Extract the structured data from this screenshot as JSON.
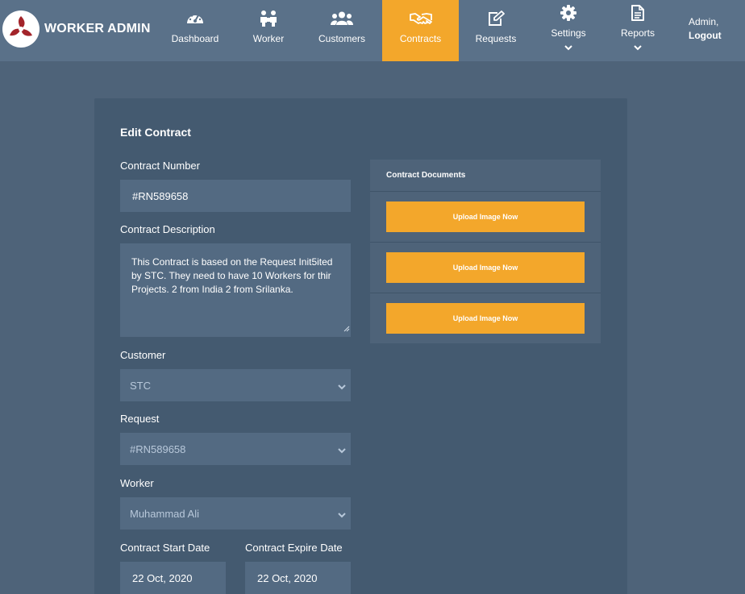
{
  "brand": {
    "name": "WORKER ADMIN"
  },
  "nav": {
    "items": [
      {
        "label": "Dashboard",
        "icon": "dashboard-icon"
      },
      {
        "label": "Worker",
        "icon": "worker-icon"
      },
      {
        "label": "Customers",
        "icon": "customers-icon"
      },
      {
        "label": "Contracts",
        "icon": "handshake-icon",
        "active": true
      },
      {
        "label": "Requests",
        "icon": "edit-icon"
      },
      {
        "label": "Settings",
        "icon": "gear-icon"
      },
      {
        "label": "Reports",
        "icon": "document-icon"
      }
    ],
    "user_greeting": "Admin,",
    "logout": "Logout"
  },
  "form": {
    "title": "Edit Contract",
    "contract_number": {
      "label": "Contract Number",
      "value": "#RN589658"
    },
    "contract_description": {
      "label": "Contract Description",
      "value": "This Contract is based on the Request Init5ited by STC. They need to have 10 Workers for thir Projects. 2 from India 2 from Srilanka."
    },
    "customer": {
      "label": "Customer",
      "value": "STC"
    },
    "request": {
      "label": "Request",
      "value": "#RN589658"
    },
    "worker": {
      "label": "Worker",
      "value": "Muhammad Ali"
    },
    "start_date": {
      "label": "Contract Start Date",
      "value": "22 Oct, 2020"
    },
    "expire_date": {
      "label": "Contract Expire Date",
      "value": "22 Oct, 2020"
    }
  },
  "documents": {
    "title": "Contract Documents",
    "upload_buttons": [
      "Upload Image Now",
      "Upload Image Now",
      "Upload Image Now"
    ]
  },
  "colors": {
    "accent": "#f3a72b",
    "topbar": "#5a7189",
    "background": "#4e6379",
    "card": "#445a70",
    "field": "#536a82",
    "select_text": "#b8c8da"
  }
}
